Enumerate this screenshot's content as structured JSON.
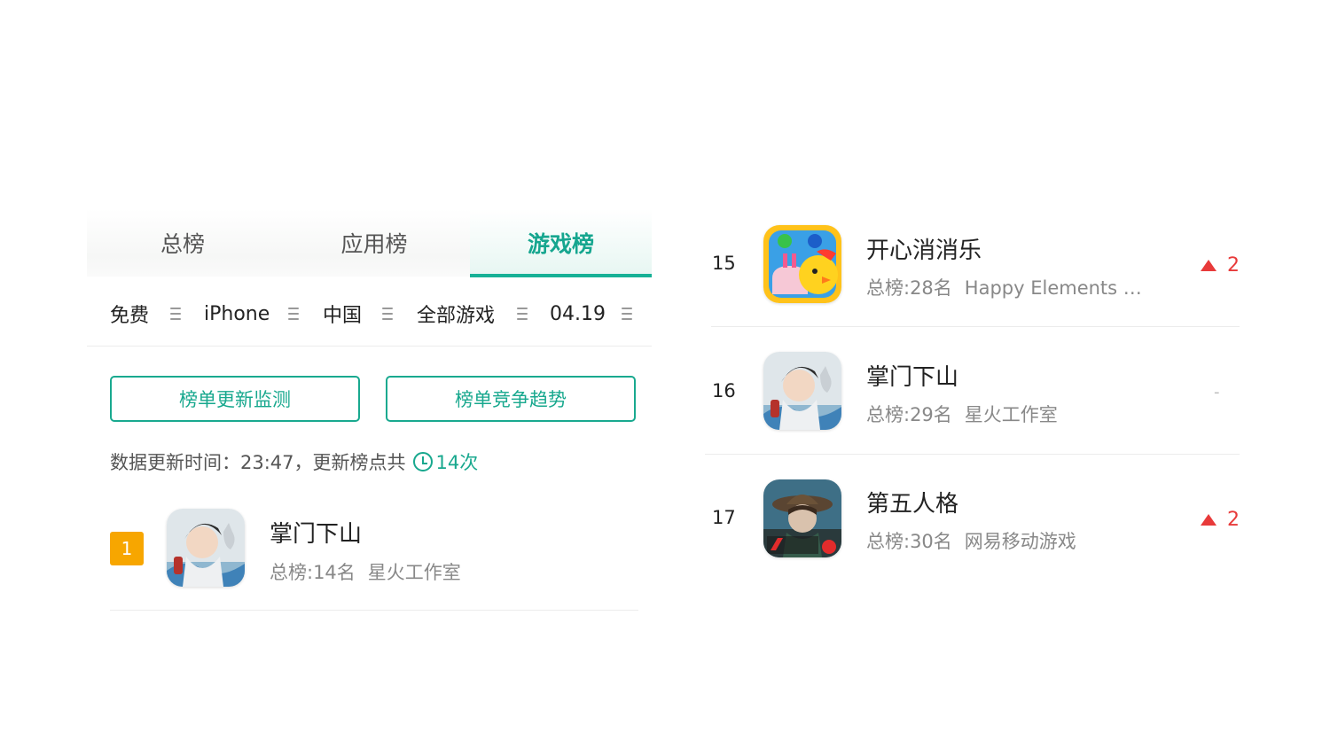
{
  "tabs": [
    {
      "label": "总榜"
    },
    {
      "label": "应用榜"
    },
    {
      "label": "游戏榜",
      "active": true
    }
  ],
  "filters": {
    "price": "免费",
    "device": "iPhone",
    "region": "中国",
    "category": "全部游戏",
    "date": "04.19"
  },
  "buttons": {
    "monitor": "榜单更新监测",
    "trend": "榜单竞争趋势"
  },
  "update_info": {
    "text": "数据更新时间：23:47，更新榜点共",
    "count": "14次"
  },
  "top_item": {
    "rank": "1",
    "name": "掌门下山",
    "overall": "总榜:14名",
    "developer": "星火工作室",
    "icon": "zhangmen-game-icon"
  },
  "list": [
    {
      "rank": "15",
      "name": "开心消消乐",
      "overall": "总榜:28名",
      "developer": "Happy Elements …",
      "change": "2",
      "direction": "up",
      "icon": "kaixin-game-icon"
    },
    {
      "rank": "16",
      "name": "掌门下山",
      "overall": "总榜:29名",
      "developer": "星火工作室",
      "change": "-",
      "direction": "none",
      "icon": "zhangmen-game-icon"
    },
    {
      "rank": "17",
      "name": "第五人格",
      "overall": "总榜:30名",
      "developer": "网易移动游戏",
      "change": "2",
      "direction": "up",
      "icon": "identity-v-game-icon"
    }
  ],
  "colors": {
    "accent": "#16a68f",
    "rank_badge": "#f7a600",
    "up": "#e83a3a"
  }
}
